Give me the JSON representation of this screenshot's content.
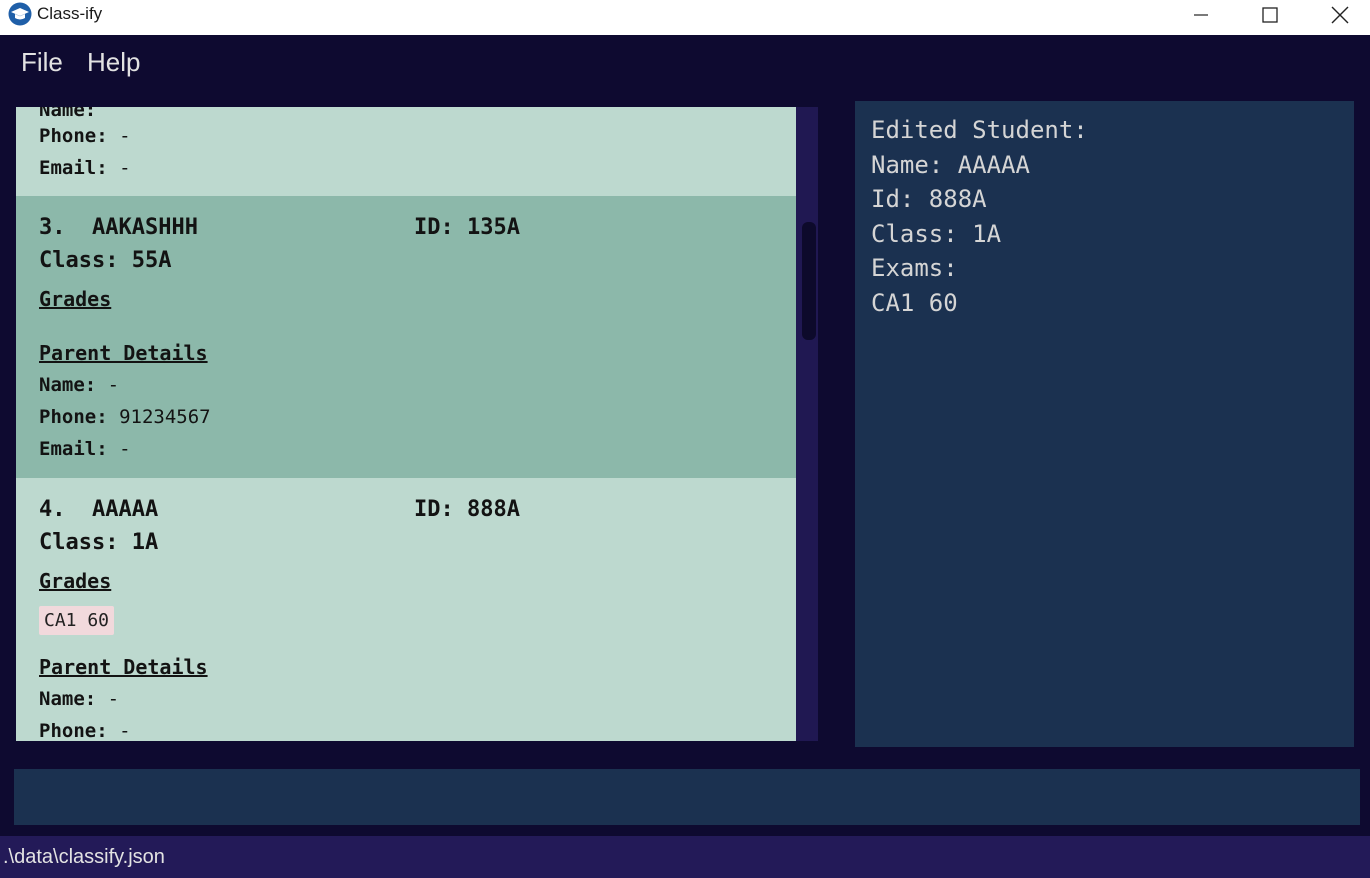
{
  "window": {
    "title": "Class-ify"
  },
  "menu": {
    "file": "File",
    "help": "Help"
  },
  "labels": {
    "name": "Name:",
    "phone": "Phone:",
    "email": "Email:",
    "class": "Class:",
    "id": "ID:",
    "grades": "Grades",
    "parent_details": "Parent Details"
  },
  "students": [
    {
      "phone": "-",
      "email": "-"
    },
    {
      "index": "3.",
      "name": "AAKASHHH",
      "id": "135A",
      "class": "55A",
      "parent_name": "-",
      "phone": "91234567",
      "email": "-",
      "selected": true
    },
    {
      "index": "4.",
      "name": "AAAAA",
      "id": "888A",
      "class": "1A",
      "grades": [
        "CA1 60"
      ],
      "parent_name": "-",
      "phone": "-"
    }
  ],
  "result": {
    "lines": [
      "Edited Student:",
      "Name: AAAAA",
      "Id: 888A",
      "Class: 1A",
      "Exams:",
      "CA1 60"
    ]
  },
  "command": {
    "value": "",
    "placeholder": ""
  },
  "status": {
    "path": ".\\data\\classify.json"
  },
  "colors": {
    "window_bg": "#0e0a30",
    "card_light": "#bdd9cf",
    "card_selected": "#8cb8aa",
    "result_bg": "#1b3150",
    "status_bg": "#231a58",
    "grade_tag_bg": "#f1d9dc"
  }
}
